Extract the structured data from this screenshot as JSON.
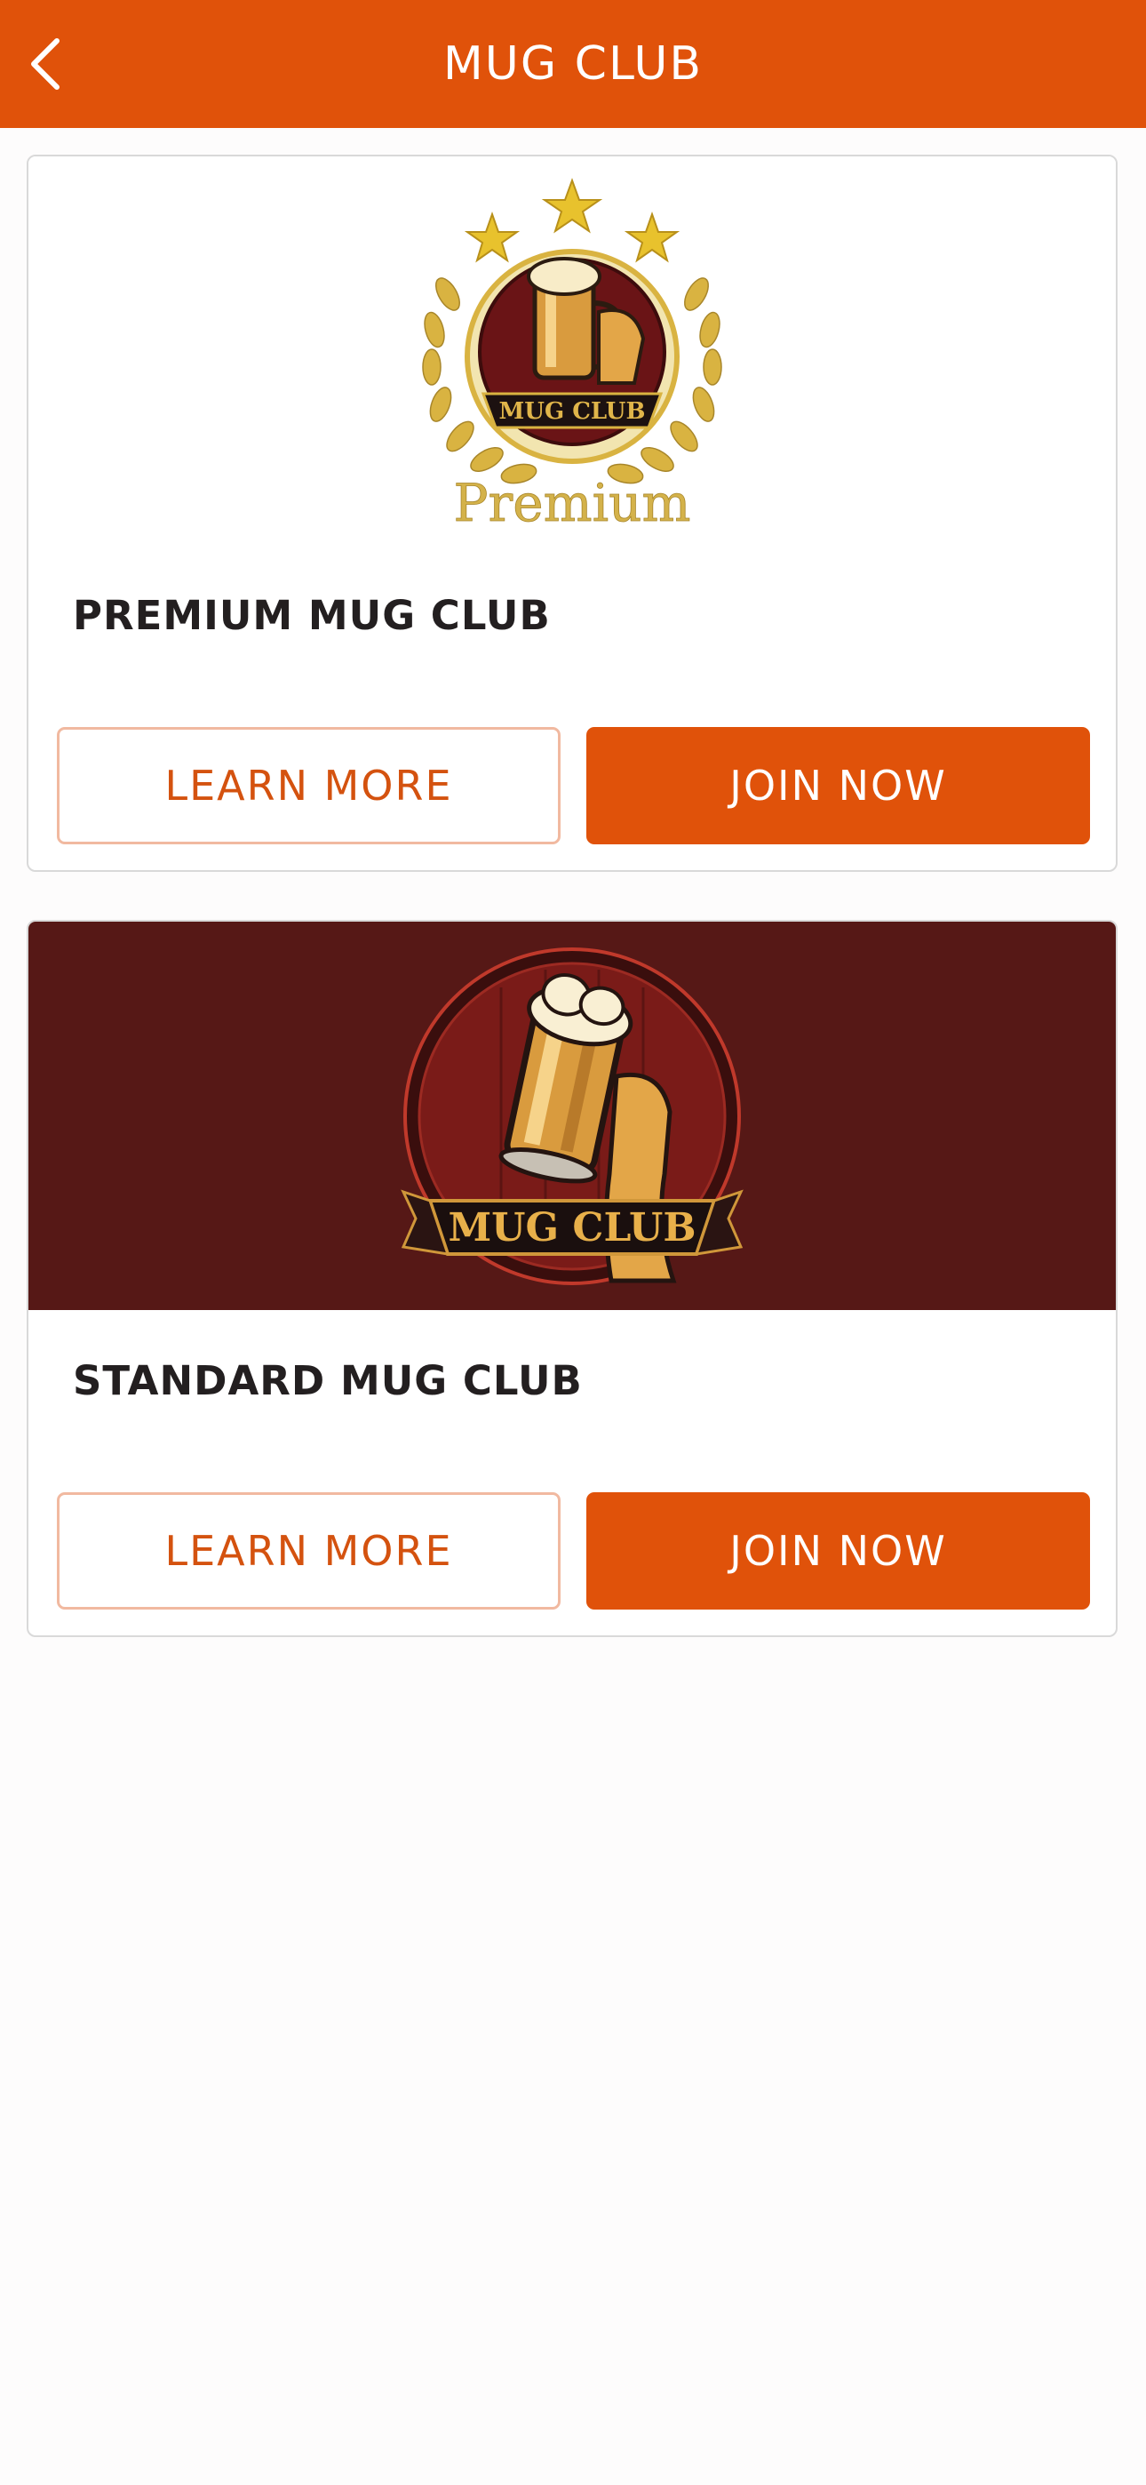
{
  "header": {
    "title": "MUG CLUB",
    "back_icon": "chevron-left-icon",
    "background_color": "#e0520a"
  },
  "clubs": [
    {
      "title": "PREMIUM MUG CLUB",
      "logo_text": "MUG CLUB",
      "logo_caption": "Premium",
      "learn_more_label": "LEARN MORE",
      "join_now_label": "JOIN NOW"
    },
    {
      "title": "STANDARD MUG CLUB",
      "logo_text": "MUG CLUB",
      "learn_more_label": "LEARN MORE",
      "join_now_label": "JOIN NOW",
      "banner_color": "#561816"
    }
  ],
  "colors": {
    "accent": "#e0520a",
    "outline_border": "#f1b9a0",
    "gold": "#d9b341"
  }
}
